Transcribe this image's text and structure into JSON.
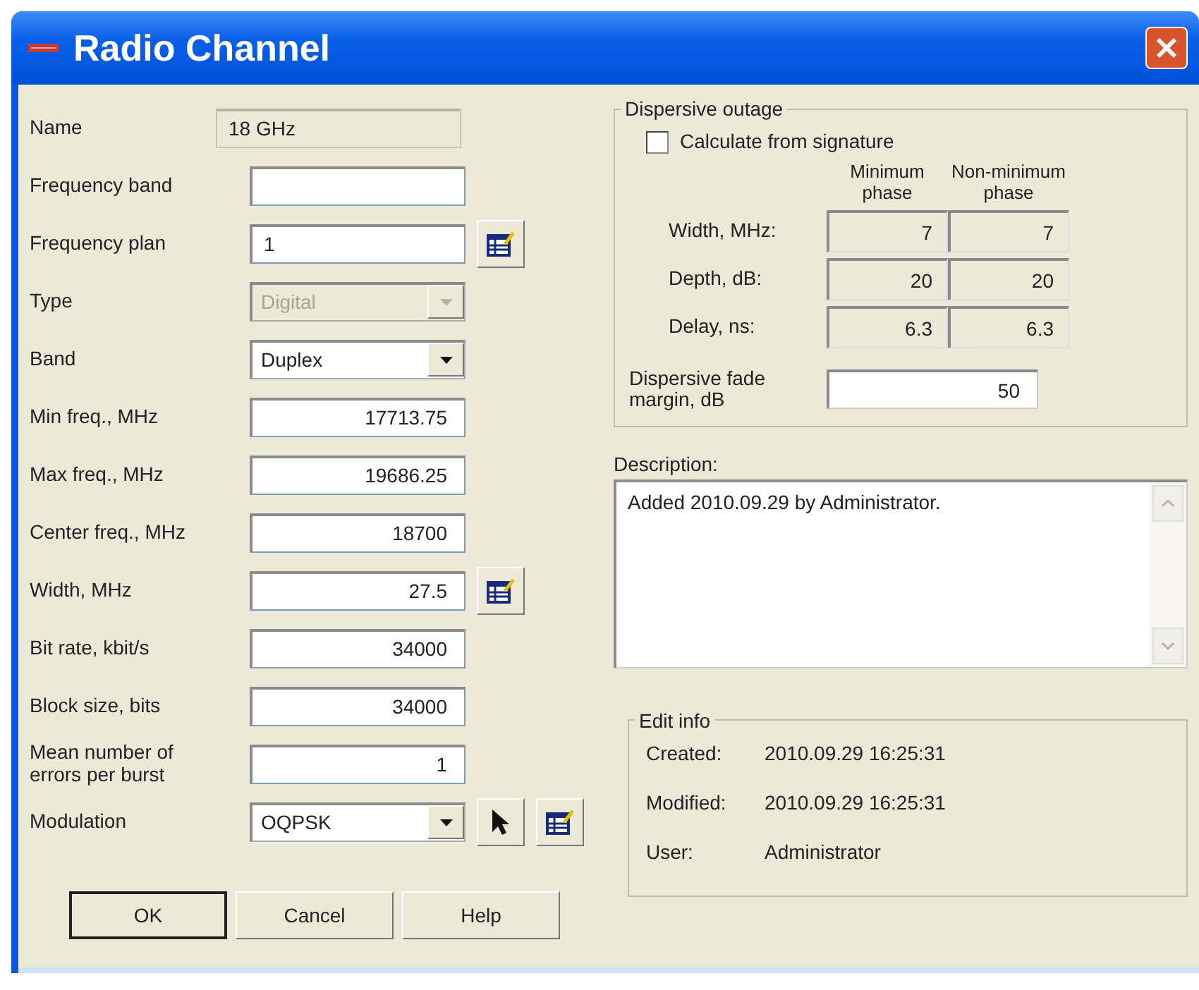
{
  "window": {
    "title": "Radio Channel"
  },
  "fields": [
    {
      "kind": "readonly",
      "label": "Name",
      "value": "18 GHz"
    },
    {
      "kind": "text",
      "label": "Frequency band"
    },
    {
      "kind": "text",
      "label": "Frequency plan",
      "value": "1",
      "table_button": true
    },
    {
      "kind": "combo",
      "label": "Type",
      "value": "Digital",
      "disabled": true
    },
    {
      "kind": "combo",
      "label": "Band",
      "value": "Duplex",
      "disabled": false
    },
    {
      "kind": "number",
      "label": "Min freq., MHz",
      "value": "17713.75"
    },
    {
      "kind": "number",
      "label": "Max freq., MHz",
      "value": "19686.25"
    },
    {
      "kind": "number",
      "label": "Center freq., MHz",
      "value": "18700"
    },
    {
      "kind": "number",
      "label": "Width, MHz",
      "value": "27.5",
      "table_button": true
    },
    {
      "kind": "number",
      "label": "Bit rate, kbit/s",
      "value": "34000"
    },
    {
      "kind": "number",
      "label": "Block size, bits",
      "value": "34000"
    },
    {
      "kind": "number",
      "label": "Mean number of errors per burst",
      "value": "1"
    },
    {
      "kind": "combo",
      "label": "Modulation",
      "value": "OQPSK",
      "disabled": false,
      "pointer_button": true,
      "table_button": true
    }
  ],
  "dispersive_outage": {
    "title": "Dispersive outage",
    "checkbox": {
      "label": "Calculate from signature",
      "checked": false
    },
    "column_headers": [
      "Minimum phase",
      "Non-minimum phase"
    ],
    "rows": [
      {
        "label": "Width, MHz:",
        "values": [
          "7",
          "7"
        ]
      },
      {
        "label": "Depth, dB:",
        "values": [
          "20",
          "20"
        ]
      },
      {
        "label": "Delay, ns:",
        "values": [
          "6.3",
          "6.3"
        ]
      }
    ],
    "fade_margin": {
      "label": "Dispersive fade margin, dB",
      "value": "50"
    }
  },
  "description": {
    "label": "Description:",
    "text": "Added 2010.09.29 by Administrator."
  },
  "edit_info": {
    "title": "Edit info",
    "rows": [
      {
        "label": "Created:",
        "value": "2010.09.29 16:25:31"
      },
      {
        "label": "Modified:",
        "value": "2010.09.29 16:25:31"
      },
      {
        "label": "User:",
        "value": "Administrator"
      }
    ]
  },
  "buttons": [
    {
      "label": "OK",
      "default": true
    },
    {
      "label": "Cancel",
      "default": false
    },
    {
      "label": "Help",
      "default": false
    }
  ]
}
